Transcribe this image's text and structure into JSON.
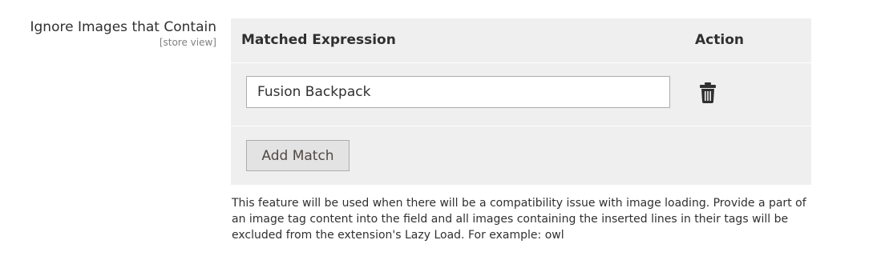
{
  "field": {
    "label": "Ignore Images that Contain",
    "scope": "[store view]"
  },
  "grid": {
    "columns": {
      "expression": "Matched Expression",
      "action": "Action"
    },
    "rows": [
      {
        "value": "Fusion Backpack"
      }
    ],
    "add_button_label": "Add Match"
  },
  "note": "This feature will be used when there will be a compatibility issue with image loading. Provide a part of an image tag content into the field and all images containing the inserted lines in their tags will be excluded from the extension's Lazy Load. For example: owl",
  "icons": {
    "delete": "trash-icon"
  },
  "colors": {
    "grid_background": "#efefef",
    "text": "#303030",
    "scope_text": "#808080",
    "button_background": "#e3e3e3"
  }
}
